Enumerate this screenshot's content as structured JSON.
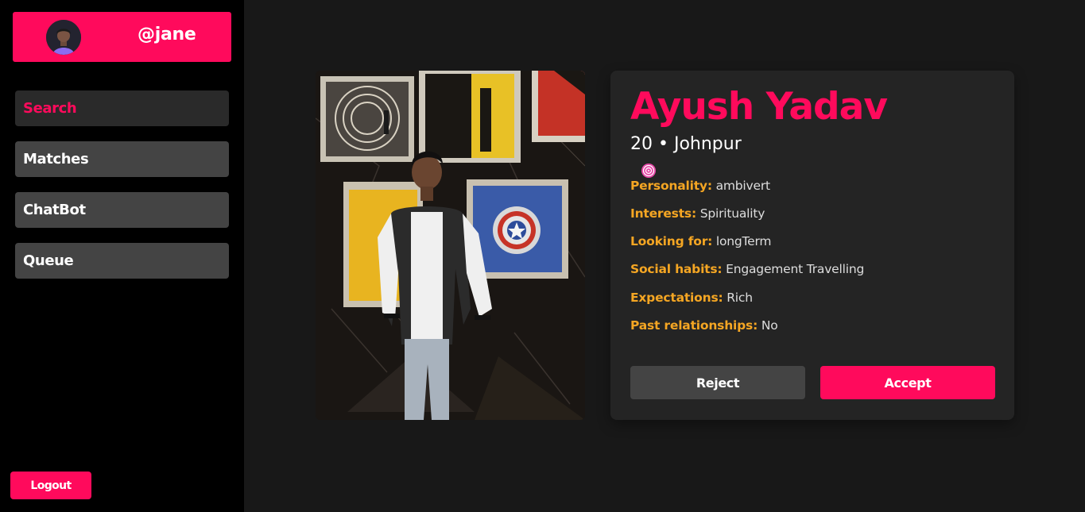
{
  "user": {
    "handle": "@jane"
  },
  "nav": [
    {
      "label": "Search",
      "active": true
    },
    {
      "label": "Matches"
    },
    {
      "label": "ChatBot"
    },
    {
      "label": "Queue"
    }
  ],
  "logout_label": "Logout",
  "profile": {
    "name": "Ayush Yadav",
    "age_location": "20 • Johnpur",
    "details": [
      {
        "key": "Personality:",
        "value": "ambivert"
      },
      {
        "key": "Interests:",
        "value": "Spirituality"
      },
      {
        "key": "Looking for:",
        "value": "longTerm"
      },
      {
        "key": "Social habits:",
        "value": "Engagement Travelling"
      },
      {
        "key": "Expectations:",
        "value": "Rich"
      },
      {
        "key": "Past relationships:",
        "value": "No"
      }
    ]
  },
  "actions": {
    "reject": "Reject",
    "accept": "Accept"
  },
  "colors": {
    "accent": "#ff0a5c",
    "label": "#f5a623",
    "sidebar": "#000000",
    "background": "#181818"
  }
}
